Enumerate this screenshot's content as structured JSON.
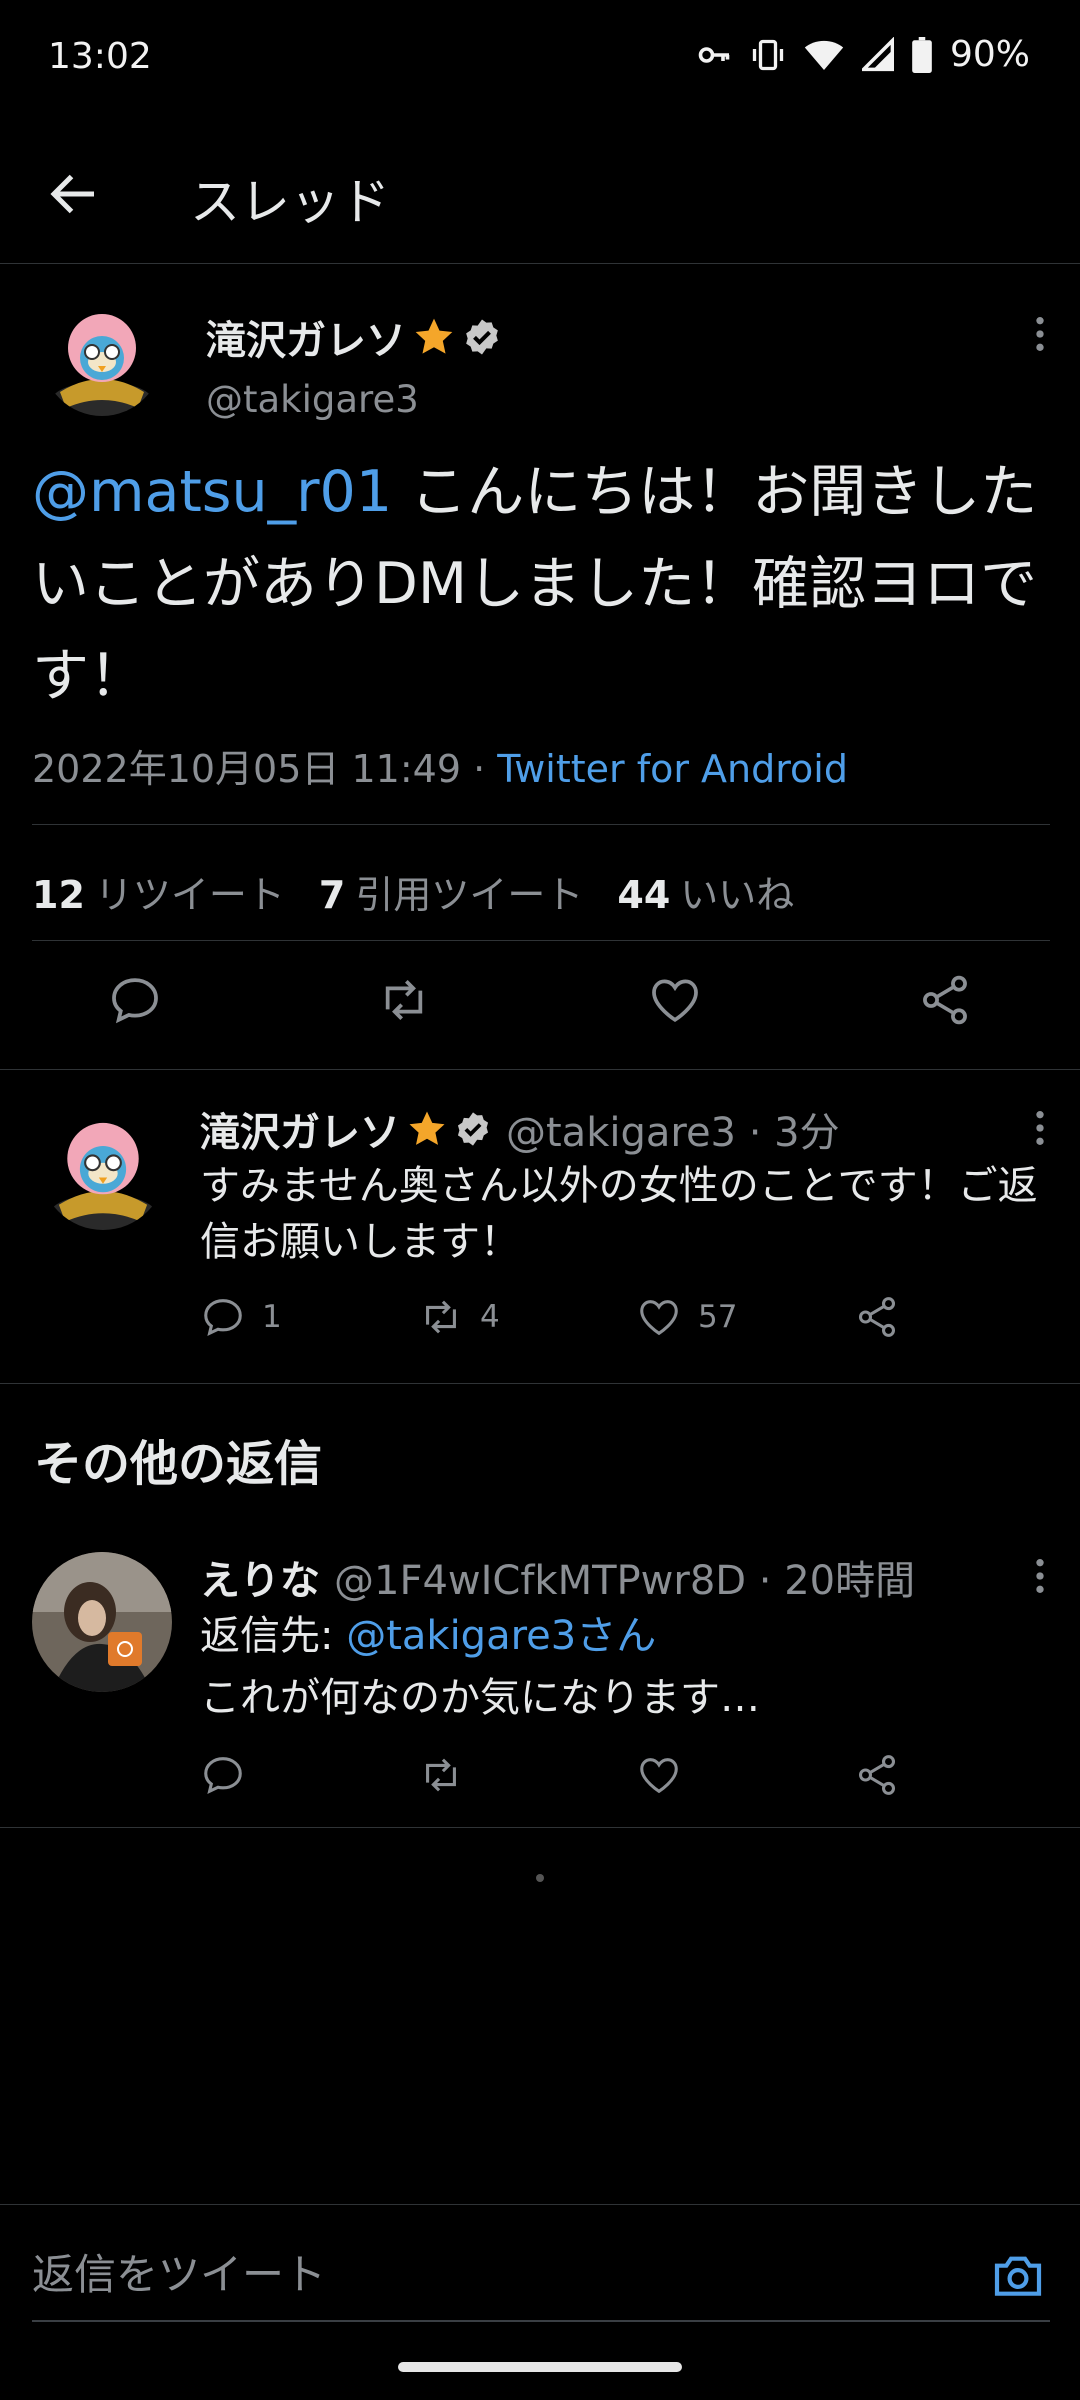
{
  "status_bar": {
    "time": "13:02",
    "battery": "90%",
    "icons": [
      "key-icon",
      "vibrate-icon",
      "wifi-icon",
      "signal-icon",
      "battery-icon"
    ]
  },
  "header": {
    "title": "スレッド"
  },
  "main_tweet": {
    "name": "滝沢ガレソ",
    "handle": "@takigare3",
    "mention": "@matsu_r01",
    "text": " こんにちは！お聞きしたいことがありDMしました！確認ヨロです！",
    "date": "2022年10月05日 11:49",
    "separator": " · ",
    "source": "Twitter for Android",
    "stats": {
      "retweets_count": "12",
      "retweets_label": "リツイート",
      "quotes_count": "7",
      "quotes_label": "引用ツイート",
      "likes_count": "44",
      "likes_label": "いいね"
    }
  },
  "reply_1": {
    "name": "滝沢ガレソ",
    "handle_time": "@takigare3 · 3分",
    "text": "すみません奥さん以外の女性のことです！ご返信お願いします！",
    "replies": "1",
    "retweets": "4",
    "likes": "57"
  },
  "section_title": "その他の返信",
  "reply_2": {
    "name": "えりな",
    "handle_time": "@1F4wICfkMTPwr8D · 20時間",
    "reply_to_prefix": "返信先: ",
    "reply_to_link": "@takigare3さん",
    "text": "これが何なのか気になります…"
  },
  "compose": {
    "placeholder": "返信をツイート"
  },
  "colors": {
    "link": "#4f9ee8",
    "star": "#f4a62a",
    "background": "#000000"
  }
}
